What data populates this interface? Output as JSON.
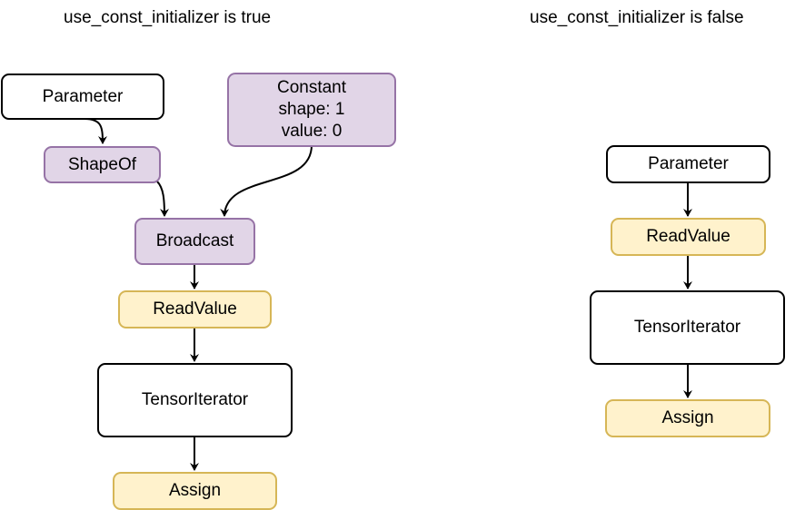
{
  "diagram": {
    "left": {
      "title": "use_const_initializer is true",
      "nodes": {
        "parameter": "Parameter",
        "shapeof": "ShapeOf",
        "constant": "Constant\nshape: 1\nvalue: 0",
        "broadcast": "Broadcast",
        "readvalue": "ReadValue",
        "tensoriterator": "TensorIterator",
        "assign": "Assign"
      },
      "edges": [
        [
          "Parameter",
          "ShapeOf"
        ],
        [
          "ShapeOf",
          "Broadcast"
        ],
        [
          "Constant",
          "Broadcast"
        ],
        [
          "Broadcast",
          "ReadValue"
        ],
        [
          "ReadValue",
          "TensorIterator"
        ],
        [
          "TensorIterator",
          "Assign"
        ]
      ]
    },
    "right": {
      "title": "use_const_initializer is false",
      "nodes": {
        "parameter": "Parameter",
        "readvalue": "ReadValue",
        "tensoriterator": "TensorIterator",
        "assign": "Assign"
      },
      "edges": [
        [
          "Parameter",
          "ReadValue"
        ],
        [
          "ReadValue",
          "TensorIterator"
        ],
        [
          "TensorIterator",
          "Assign"
        ]
      ]
    },
    "colors": {
      "purple_fill": "#e1d5e7",
      "purple_stroke": "#9673a6",
      "yellow_fill": "#fff2cc",
      "yellow_stroke": "#d6b656"
    }
  }
}
